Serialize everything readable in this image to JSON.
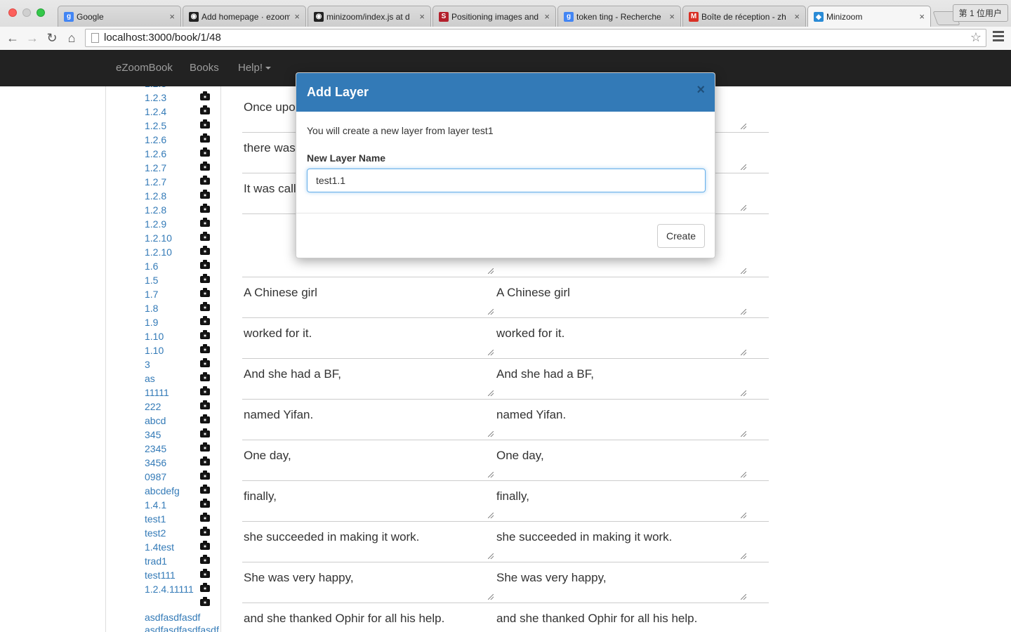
{
  "browser": {
    "tabs": [
      {
        "label": "Google",
        "favicon": "google",
        "color": "#4285f4",
        "glyph": "g"
      },
      {
        "label": "Add homepage · ezoom",
        "favicon": "github",
        "color": "#222222",
        "glyph": "◉"
      },
      {
        "label": "minizoom/index.js at d",
        "favicon": "github",
        "color": "#222222",
        "glyph": "◉"
      },
      {
        "label": "Positioning images and",
        "favicon": "scribd",
        "color": "#b3202c",
        "glyph": "S"
      },
      {
        "label": "token ting - Recherche",
        "favicon": "google",
        "color": "#4285f4",
        "glyph": "g"
      },
      {
        "label": "Boîte de réception - zh",
        "favicon": "gmail",
        "color": "#d93025",
        "glyph": "M"
      },
      {
        "label": "Minizoom",
        "favicon": "minizoom",
        "color": "#2a8bd6",
        "glyph": "◆",
        "active": true
      }
    ],
    "profile": "第 1 位用户",
    "url": "localhost:3000/book/1/48"
  },
  "nav": {
    "brand": "eZoomBook",
    "books": "Books",
    "help": "Help!"
  },
  "sidebar": {
    "partial_top": "1.2.3",
    "items": [
      "1.2.3",
      "1.2.4",
      "1.2.5",
      "1.2.6",
      "1.2.6",
      "1.2.7",
      "1.2.7",
      "1.2.8",
      "1.2.8",
      "1.2.9",
      "1.2.10",
      "1.2.10",
      "1.6",
      "1.5",
      "1.7",
      "1.8",
      "1.9",
      "1.10",
      "1.10",
      "3",
      "as",
      "11111",
      "222",
      "abcd",
      "345",
      "2345",
      "3456",
      "0987",
      "abcdefg",
      "1.4.1",
      "test1",
      "test2",
      "1.4test",
      "trad1",
      "test111",
      "1.2.4.11111",
      ""
    ],
    "bottom_items": [
      "asdfasdfasdf",
      "asdfasdfasdfasdf"
    ]
  },
  "content": {
    "rows": [
      {
        "left": "Once upo",
        "right": ""
      },
      {
        "left": "there was",
        "right": ""
      },
      {
        "left": "It was call",
        "right": ""
      },
      {
        "left": "",
        "right": ""
      },
      {
        "left": "A Chinese girl",
        "right": "A Chinese girl"
      },
      {
        "left": "worked for it.",
        "right": "worked for it."
      },
      {
        "left": "And she had a BF,",
        "right": "And she had a BF,"
      },
      {
        "left": "named Yifan.",
        "right": "named Yifan."
      },
      {
        "left": "One day,",
        "right": "One day,"
      },
      {
        "left": "finally,",
        "right": "finally,"
      },
      {
        "left": "she succeeded in making it work.",
        "right": "she succeeded in making it work."
      },
      {
        "left": "She was very happy,",
        "right": "She was very happy,"
      },
      {
        "left": "and she thanked Ophir for all his help.",
        "right": "and she thanked Ophir for all his help."
      }
    ]
  },
  "modal": {
    "title": "Add Layer",
    "close": "×",
    "message": "You will create a new layer from layer test1",
    "field_label": "New Layer Name",
    "field_value": "test1.1",
    "create_button": "Create"
  }
}
